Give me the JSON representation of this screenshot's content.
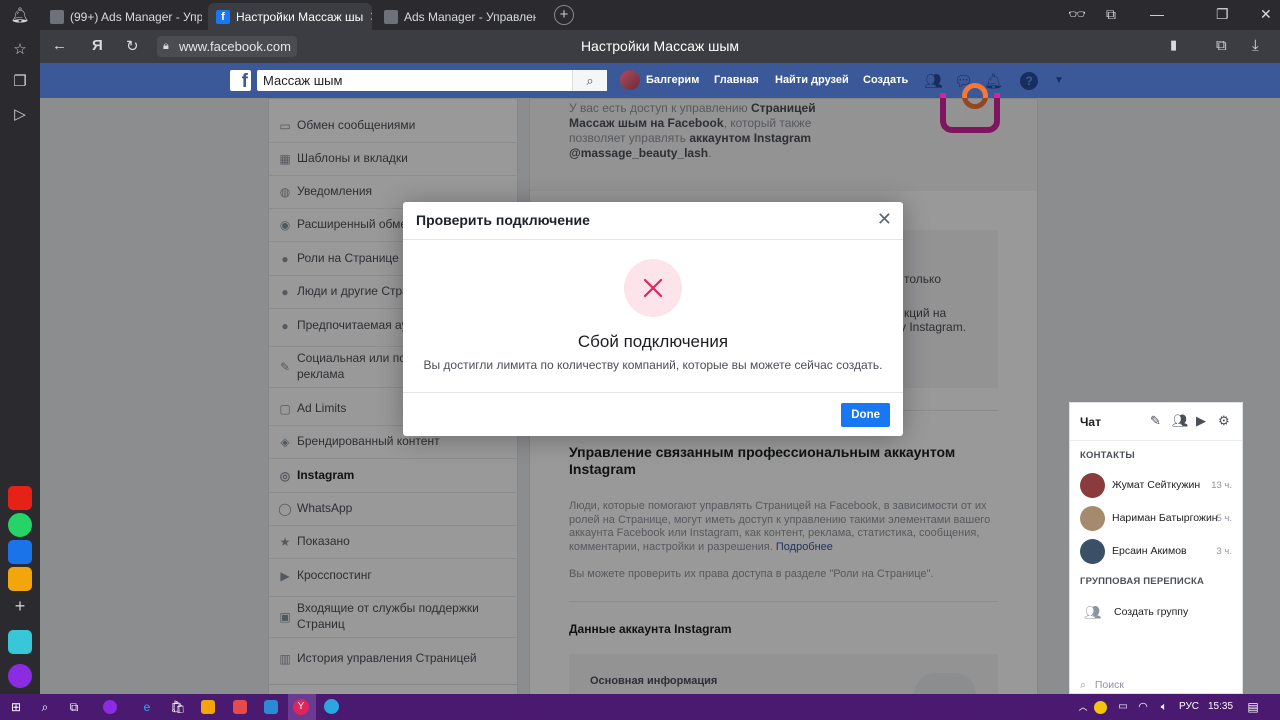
{
  "browser": {
    "tabs": [
      {
        "title": "(99+) Ads Manager - Упра",
        "active": false
      },
      {
        "title": "Настройки Массаж шы",
        "active": true
      },
      {
        "title": "Ads Manager - Управлени",
        "active": false
      }
    ],
    "url": "www.facebook.com",
    "page_title": "Настройки Массаж шым",
    "yandex_glyph": "Я"
  },
  "facebook": {
    "search_value": "Массаж шым",
    "user_name": "Балгерим",
    "nav": {
      "home": "Главная",
      "find_friends": "Найти друзей",
      "create": "Создать"
    }
  },
  "menu": {
    "items": [
      {
        "label": "Обмен сообщениями",
        "icon": "chat-bubble-icon"
      },
      {
        "label": "Шаблоны и вкладки",
        "icon": "grid-icon"
      },
      {
        "label": "Уведомления",
        "icon": "globe-icon"
      },
      {
        "label": "Расширенный обме",
        "icon": "messenger-icon"
      },
      {
        "label": "Роли на Странице",
        "icon": "person-icon"
      },
      {
        "label": "Люди и другие Стра",
        "icon": "people-icon"
      },
      {
        "label": "Предпочитаемая ау",
        "icon": "people-icon"
      },
      {
        "label": "Социальная или по\nреклама",
        "icon": "wrench-icon"
      },
      {
        "label": "Ad Limits",
        "icon": "ad-icon"
      },
      {
        "label": "Брендированный контент",
        "icon": "handshake-icon"
      },
      {
        "label": "Instagram",
        "icon": "instagram-icon",
        "active": true
      },
      {
        "label": "WhatsApp",
        "icon": "whatsapp-icon"
      },
      {
        "label": "Показано",
        "icon": "star-icon"
      },
      {
        "label": "Кросспостинг",
        "icon": "video-icon"
      },
      {
        "label": "Входящие от службы поддержки\nСтраниц",
        "icon": "inbox-icon"
      },
      {
        "label": "История управления Страницей",
        "icon": "history-icon"
      }
    ]
  },
  "main": {
    "intro_a": "У вас есть доступ к управлению ",
    "intro_b": "Страницей Массаж шым на Facebook",
    "intro_c": ", который также позволяет управлять ",
    "intro_d": "аккаунтом Instagram @massage_beauty_lash",
    "intro_e": ".",
    "peek_1": "только",
    "peek_2": "кций на",
    "peek_3": "y Instagram.",
    "section_title": "Управление связанным профессиональным аккаунтом Instagram",
    "section_desc": "Люди, которые помогают управлять Страницей на Facebook, в зависимости от их ролей на Странице, могут иметь доступ к управлению такими элементами вашего аккаунта Facebook или Instagram, как контент, реклама, статистика, сообщения, комментарии, настройки и разрешения.",
    "section_link": "Подробнее",
    "section_note": "Вы можете проверить их права доступа в разделе \"Роли на Странице\".",
    "account_title": "Данные аккаунта Instagram",
    "basic_info": "Основная информация"
  },
  "modal": {
    "title": "Проверить подключение",
    "heading": "Сбой подключения",
    "message": "Вы достигли лимита по количеству компаний, которые вы можете сейчас создать.",
    "done": "Done",
    "error_color": "#e0245e"
  },
  "chat": {
    "title": "Чат",
    "contacts_label": "КОНТАКТЫ",
    "contacts": [
      {
        "name": "Жумат Сейткужин",
        "time": "13 ч."
      },
      {
        "name": "Нариман Батыргожин",
        "time": "5 ч."
      },
      {
        "name": "Ерсаин Акимов",
        "time": "3 ч."
      }
    ],
    "group_label": "ГРУППОВАЯ ПЕРЕПИСКА",
    "create_group": "Создать группу",
    "search_placeholder": "Поиск"
  },
  "taskbar": {
    "lang": "РУС",
    "time": "15:35"
  },
  "colors": {
    "fb_blue": "#3b5998",
    "button_blue": "#1877f2",
    "taskbar": "#4a1a70",
    "browser_dark": "#2b2b2f"
  }
}
